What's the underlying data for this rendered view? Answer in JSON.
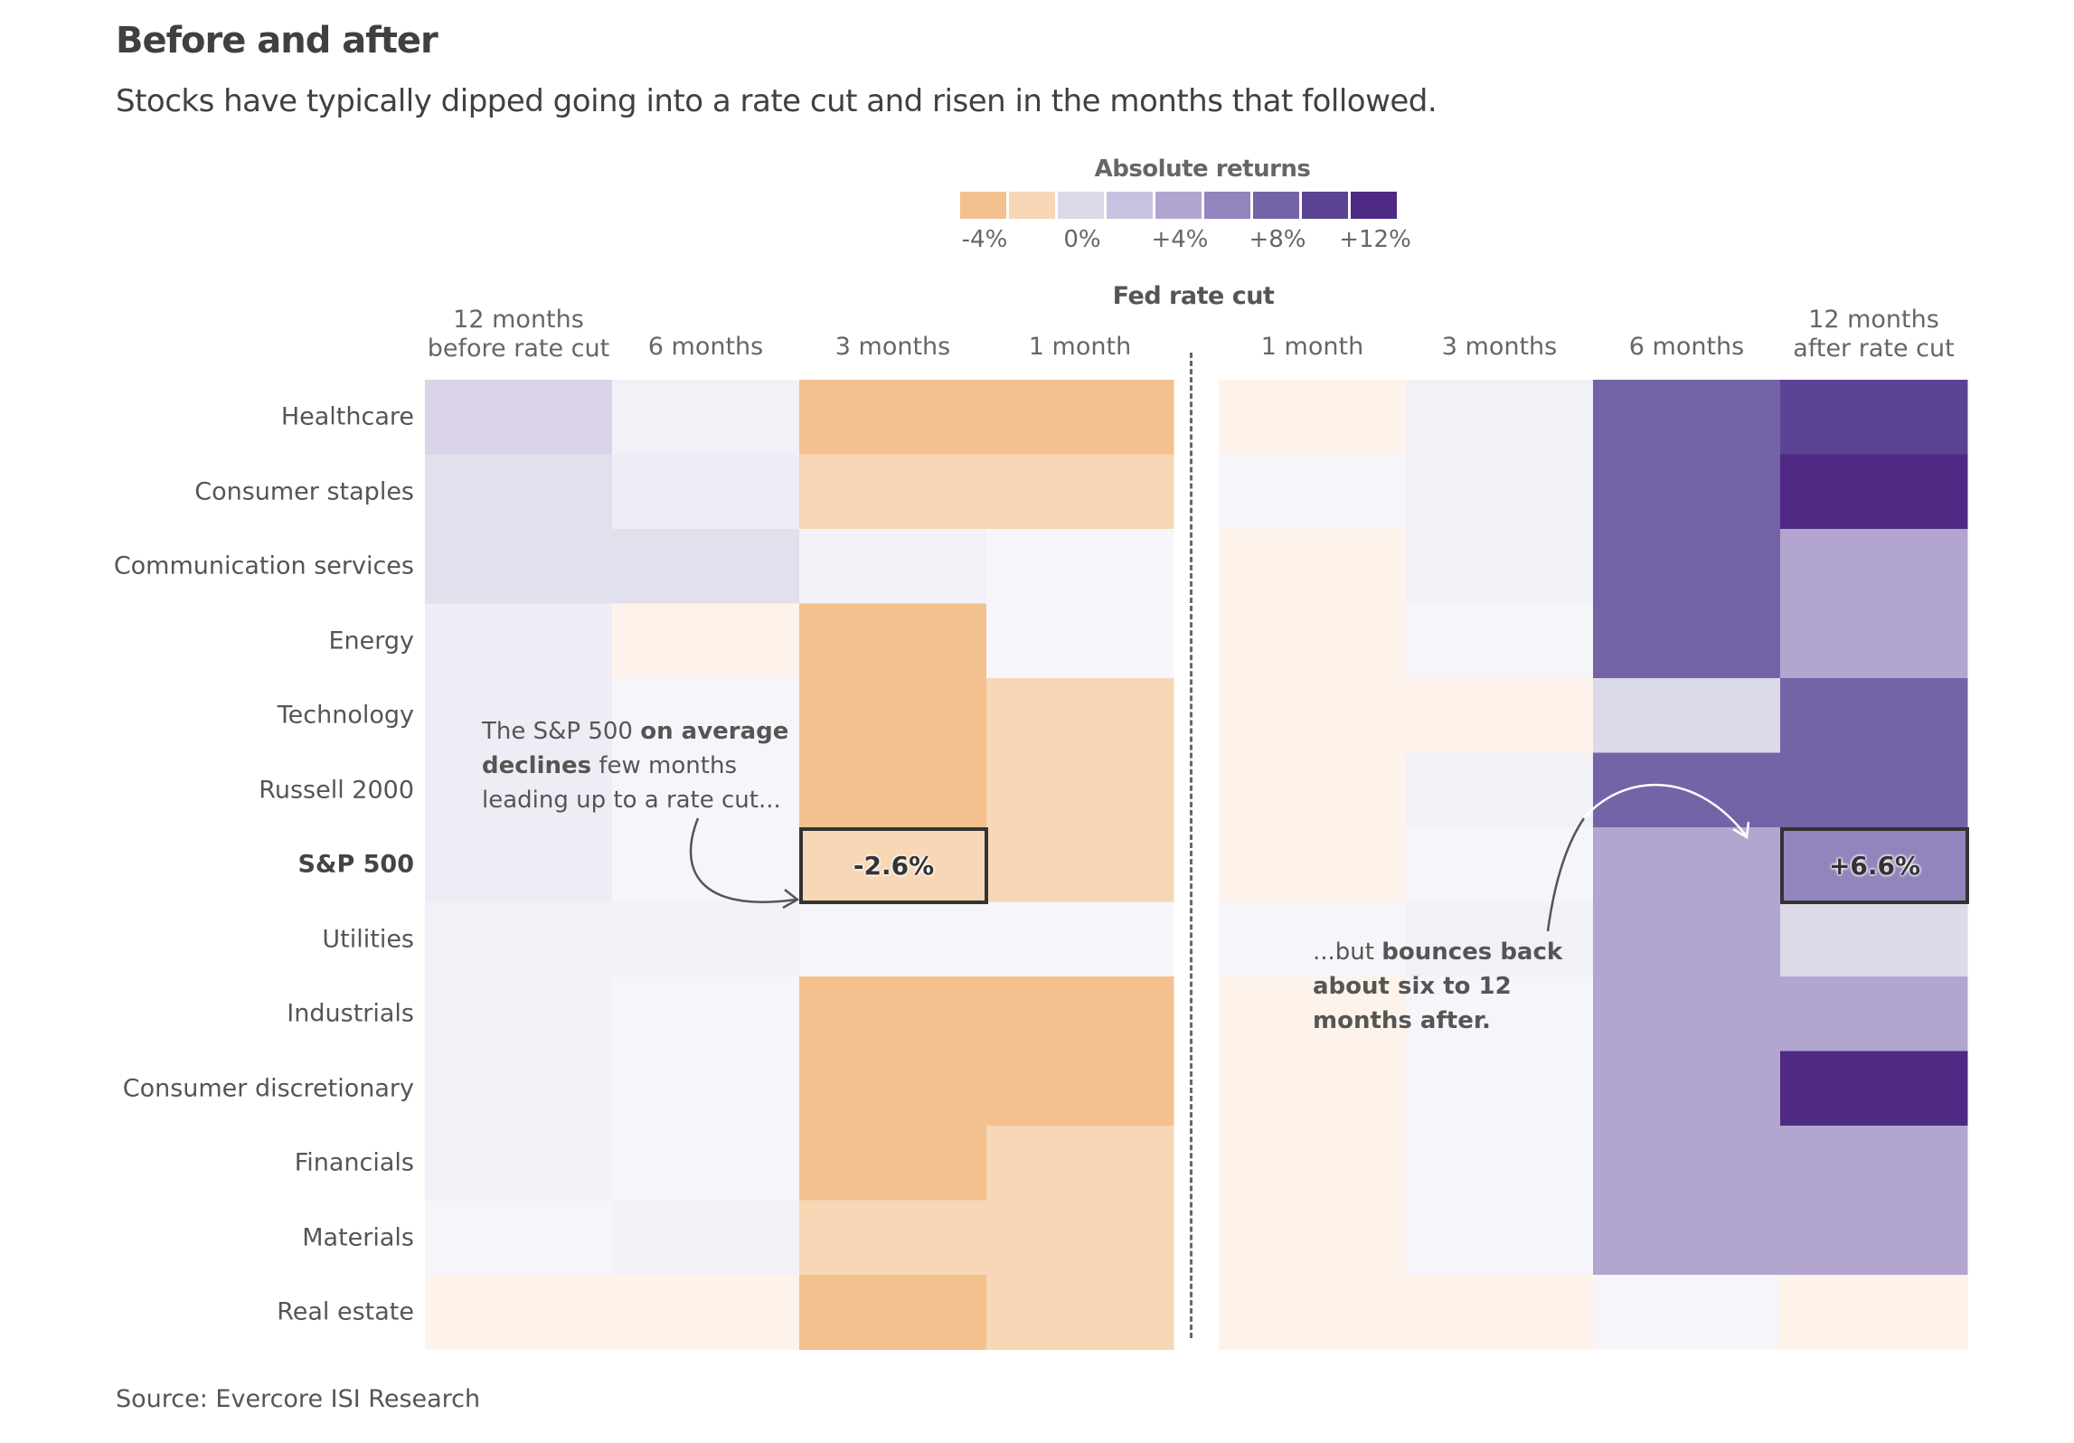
{
  "header": {
    "title": "Before and after",
    "subtitle": "Stocks have typically dipped going into a rate cut and risen in the months that followed."
  },
  "legend": {
    "title": "Absolute returns",
    "bins": [
      {
        "color": "#f2c18e",
        "from": -5,
        "to": -3
      },
      {
        "color": "#f7d7b5",
        "from": -3,
        "to": -1
      },
      {
        "color": "#dcdae9",
        "from": -1,
        "to": 1
      },
      {
        "color": "#c8c1df",
        "from": 1,
        "to": 3
      },
      {
        "color": "#b2a6d0",
        "from": 3,
        "to": 5
      },
      {
        "color": "#9384bd",
        "from": 5,
        "to": 7
      },
      {
        "color": "#7563a8",
        "from": 7,
        "to": 9
      },
      {
        "color": "#5c4495",
        "from": 9,
        "to": 11
      },
      {
        "color": "#4e2a85",
        "from": 11,
        "to": 13
      }
    ],
    "ticks": [
      "-4%",
      "0%",
      "+4%",
      "+8%",
      "+12%"
    ]
  },
  "divider_label": "Fed rate cut",
  "annotations": {
    "before": {
      "parts": [
        {
          "text": "The S&P 500 ",
          "bold": false
        },
        {
          "text": "on average declines",
          "bold": true
        },
        {
          "text": " few months leading up to a rate cut...",
          "bold": false
        }
      ],
      "callout_value": "-2.6%"
    },
    "after": {
      "parts": [
        {
          "text": "...but ",
          "bold": false
        },
        {
          "text": "bounces back about six to 12 months after.",
          "bold": true
        }
      ],
      "callout_value": "+6.6%"
    }
  },
  "source": "Source: Evercore ISI Research",
  "chart_data": {
    "type": "heatmap",
    "title": "Before and after",
    "subtitle": "Stocks have typically dipped going into a rate cut and risen in the months that followed.",
    "value_label": "Absolute returns (%)",
    "color_range": [
      -4,
      12
    ],
    "columns": [
      {
        "label_lines": [
          "12 months",
          "before rate cut"
        ],
        "side": "before"
      },
      {
        "label_lines": [
          "6 months"
        ],
        "side": "before"
      },
      {
        "label_lines": [
          "3 months"
        ],
        "side": "before"
      },
      {
        "label_lines": [
          "1 month"
        ],
        "side": "before"
      },
      {
        "label_lines": [
          "1 month"
        ],
        "side": "after"
      },
      {
        "label_lines": [
          "3 months"
        ],
        "side": "after"
      },
      {
        "label_lines": [
          "6 months"
        ],
        "side": "after"
      },
      {
        "label_lines": [
          "12 months",
          "after rate cut"
        ],
        "side": "after"
      }
    ],
    "rows": [
      {
        "label": "Healthcare",
        "bold": false,
        "values": [
          1.5,
          0.3,
          -3.5,
          -3.5,
          -0.3,
          0.3,
          7.0,
          10.0
        ]
      },
      {
        "label": "Consumer staples",
        "bold": false,
        "values": [
          0.8,
          0.5,
          -2.0,
          -2.0,
          0.1,
          0.3,
          7.0,
          12.5
        ]
      },
      {
        "label": "Communication services",
        "bold": false,
        "values": [
          0.8,
          0.7,
          0.2,
          0.1,
          -0.3,
          0.3,
          7.0,
          4.5
        ]
      },
      {
        "label": "Energy",
        "bold": false,
        "values": [
          0.5,
          -0.3,
          -3.5,
          0.1,
          -0.4,
          0.1,
          7.0,
          3.0
        ]
      },
      {
        "label": "Technology",
        "bold": false,
        "values": [
          0.5,
          0.1,
          -3.5,
          -2.0,
          -0.4,
          -0.2,
          1.0,
          7.0
        ]
      },
      {
        "label": "Russell 2000",
        "bold": false,
        "values": [
          0.5,
          0.1,
          -3.5,
          -2.0,
          -0.2,
          0.3,
          7.0,
          7.0
        ]
      },
      {
        "label": "S&P 500",
        "bold": true,
        "values": [
          0.5,
          0.1,
          -2.6,
          -2.0,
          -0.2,
          0.0,
          4.5,
          6.6
        ]
      },
      {
        "label": "Utilities",
        "bold": false,
        "values": [
          0.3,
          0.3,
          0.1,
          0.1,
          0.1,
          0.3,
          3.0,
          1.0
        ]
      },
      {
        "label": "Industrials",
        "bold": false,
        "values": [
          0.3,
          0.1,
          -3.5,
          -3.5,
          -0.2,
          0.1,
          3.0,
          4.5
        ]
      },
      {
        "label": "Consumer discretionary",
        "bold": false,
        "values": [
          0.3,
          0.1,
          -3.5,
          -3.5,
          -0.2,
          0.1,
          4.5,
          12.5
        ]
      },
      {
        "label": "Financials",
        "bold": false,
        "values": [
          0.3,
          0.1,
          -3.5,
          -2.0,
          -0.2,
          0.1,
          4.5,
          4.5
        ]
      },
      {
        "label": "Materials",
        "bold": false,
        "values": [
          0.1,
          0.3,
          -2.0,
          -2.0,
          -0.2,
          0.1,
          3.0,
          4.5
        ]
      },
      {
        "label": "Real estate",
        "bold": false,
        "values": [
          -0.2,
          -0.3,
          -3.5,
          -2.0,
          -0.3,
          -0.3,
          0.1,
          -0.2
        ]
      }
    ],
    "highlighted": [
      {
        "row": "S&P 500",
        "column_index": 2,
        "value": -2.6,
        "label": "-2.6%"
      },
      {
        "row": "S&P 500",
        "column_index": 7,
        "value": 6.6,
        "label": "+6.6%"
      }
    ]
  }
}
